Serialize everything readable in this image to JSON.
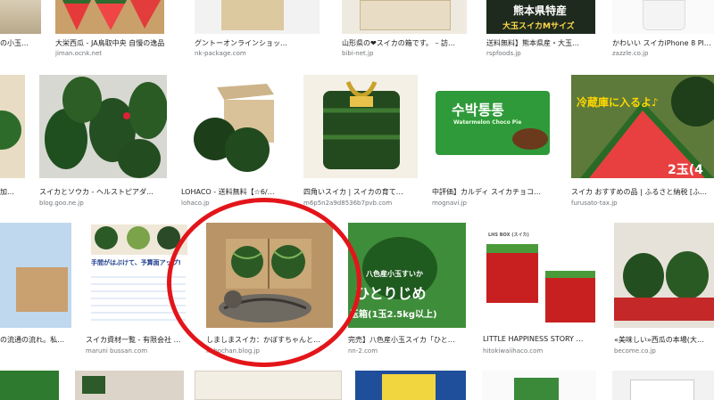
{
  "row1": [
    {
      "caption": "の小玉…",
      "source": ""
    },
    {
      "caption": "大栄西瓜 - JA鳥取中央 自慢の逸品",
      "source": "jiman.ocnk.net"
    },
    {
      "caption": "グントーオンラインショッ…",
      "source": "nk-package.com"
    },
    {
      "caption": "山形県の❤スイカの箱です。 – 訪…",
      "source": "bibi-net.jp"
    },
    {
      "caption": "送料無料】熊本県産・大玉…",
      "source": "rspfoods.jp",
      "overlay_top": "熊本県特産",
      "overlay_bottom": "大玉スイカMサイズ"
    },
    {
      "caption": "かわいい スイカiPhone 8 Pl…",
      "source": "zazzle.co.jp"
    }
  ],
  "row2": [
    {
      "caption": "加…",
      "source": ""
    },
    {
      "caption": "スイカとソウカ - ヘルストピアダ…",
      "source": "blog.goo.ne.jp"
    },
    {
      "caption": "LOHACO - 送料無料【☆6/…",
      "source": "lohaco.jp"
    },
    {
      "caption": "四角いスイカ | スイカの育て…",
      "source": "m6p5n2a9d8536b7pvb.com"
    },
    {
      "caption": "中評価】カルディ スイカチョコ…",
      "source": "mognavi.jp",
      "overlay_top": "수박통통",
      "overlay_bottom": "Watermelon Choco Pie"
    },
    {
      "caption": "スイカ おすすめの品 | ふるさと納税 [ふ…",
      "source": "furusato-tax.jp",
      "overlay_top": "冷蔵庫に入るよ♪",
      "overlay_bottom": "2玉(4"
    }
  ],
  "row3": [
    {
      "caption": "の流通の流れ。私…",
      "source": ""
    },
    {
      "caption": "スイカ資材一覧 - 有限会社 …",
      "source": "maruni bussan.com",
      "overlay_top": "手間がはぶけて、予算面アップ!"
    },
    {
      "caption": "しましまスイカ：かぼすちゃんと…",
      "source": "kabochan.blog.jp"
    },
    {
      "caption": "完売】八色産小玉スイカ「ひと…",
      "source": "nn-2.com",
      "overlay_top": "八色産小玉すいか",
      "overlay_mid": "ひとりじめ",
      "overlay_bottom": "玉箱(1玉2.5kg以上)"
    },
    {
      "caption": "LITTLE HAPPINESS STORY …",
      "source": "hitokiwaiihaco.com",
      "overlay_top": "LHS BOX (スイカ)"
    },
    {
      "caption": "«美味しい»西瓜の本場(大…",
      "source": "become.co.jp"
    }
  ],
  "colors": {
    "highlight_ring": "#e3151a",
    "watermelon_green": "#1f5a1f",
    "caption": "#222222",
    "source": "#70757a"
  }
}
